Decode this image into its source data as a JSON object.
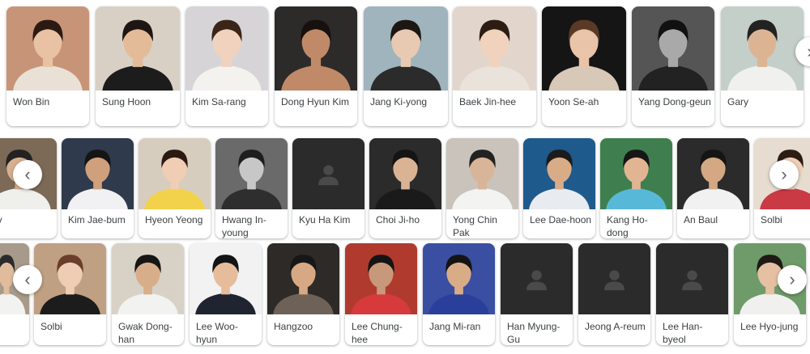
{
  "colors": {
    "placeholder_bg": "#2b2b2b",
    "placeholder_icon": "#4a4a4a",
    "label": "#3c4043"
  },
  "icons": {
    "prev": "chevron-left-icon",
    "next": "chevron-right-icon",
    "placeholder": "person-placeholder-icon"
  },
  "rows": [
    {
      "items": [
        {
          "name": "Won Bin",
          "bg": "#c89478",
          "skin": "#e9c2a3",
          "hair": "#2a1a12",
          "cloth": "#e9e1d6"
        },
        {
          "name": "Sung Hoon",
          "bg": "#d8d0c4",
          "skin": "#e3bb98",
          "hair": "#1d1612",
          "cloth": "#1c1c1c"
        },
        {
          "name": "Kim Sa-rang",
          "bg": "#d6d4d6",
          "skin": "#f0d2bf",
          "hair": "#3b2418",
          "cloth": "#f4f2ef"
        },
        {
          "name": "Dong Hyun Kim",
          "bg": "#2d2a2a",
          "skin": "#c08a68",
          "hair": "#16110e",
          "cloth": "#c08a68"
        },
        {
          "name": "Jang Ki-yong",
          "bg": "#9fb4bd",
          "skin": "#e8c9b1",
          "hair": "#1c1712",
          "cloth": "#2b2b2b"
        },
        {
          "name": "Baek Jin-hee",
          "bg": "#e2d6cc",
          "skin": "#f1d2bc",
          "hair": "#2c1c14",
          "cloth": "#e9e3dc"
        },
        {
          "name": "Yoon Se-ah",
          "bg": "#151515",
          "skin": "#e9c4a8",
          "hair": "#5a3a26",
          "cloth": "#d8c8b8"
        },
        {
          "name": "Yang Dong-geun",
          "bg": "#555555",
          "skin": "#a9a9a9",
          "hair": "#111111",
          "cloth": "#222222"
        },
        {
          "name": "Gary",
          "bg": "#c5cfc9",
          "skin": "#dcb494",
          "hair": "#222222",
          "cloth": "#f0f0ee"
        }
      ]
    },
    {
      "items": [
        {
          "name": "ary",
          "bg": "#7c6a56",
          "skin": "#d8b090",
          "hair": "#222222",
          "cloth": "#efefec"
        },
        {
          "name": "Kim Jae-bum",
          "bg": "#2f3a4c",
          "skin": "#d0a07c",
          "hair": "#151515",
          "cloth": "#f1f1f3"
        },
        {
          "name": "Hyeon Yeong",
          "bg": "#d7cdbf",
          "skin": "#f0cdb4",
          "hair": "#2a1a12",
          "cloth": "#f2d24a"
        },
        {
          "name": "Hwang In-young",
          "bg": "#6a6a6a",
          "skin": "#c7c7c7",
          "hair": "#1e1e1e",
          "cloth": "#2e2e2e"
        },
        {
          "name": "Kyu Ha Kim",
          "placeholder": true
        },
        {
          "name": "Choi Ji-ho",
          "bg": "#2b2b2b",
          "skin": "#d9b394",
          "hair": "#141414",
          "cloth": "#1a1a1a"
        },
        {
          "name": "Yong Chin Pak",
          "bg": "#c9c3bb",
          "skin": "#d8b498",
          "hair": "#222222",
          "cloth": "#f3f3f1"
        },
        {
          "name": "Lee Dae-hoon",
          "bg": "#1f5a8c",
          "skin": "#d9ac88",
          "hair": "#1b1b1b",
          "cloth": "#e8ecf0"
        },
        {
          "name": "Kang Ho-dong",
          "bg": "#3f7f4f",
          "skin": "#e2b592",
          "hair": "#161616",
          "cloth": "#58b8d8"
        },
        {
          "name": "An Baul",
          "bg": "#2b2b2b",
          "skin": "#d3a882",
          "hair": "#151515",
          "cloth": "#f1f1f1"
        },
        {
          "name": "Solbi",
          "bg": "#e6dccf",
          "skin": "#efcfb8",
          "hair": "#2c1c14",
          "cloth": "#c93a45"
        }
      ]
    },
    {
      "items": [
        {
          "name": "",
          "bg": "#a89a8a",
          "skin": "#e0bc9c",
          "hair": "#2b2b2b",
          "cloth": "#f2f2f0"
        },
        {
          "name": "Solbi",
          "bg": "#c0a082",
          "skin": "#efcdb4",
          "hair": "#6a3e2a",
          "cloth": "#1c1c1c"
        },
        {
          "name": "Gwak Dong-han",
          "bg": "#d8d2c6",
          "skin": "#d8ae8a",
          "hair": "#161616",
          "cloth": "#f2f2f0"
        },
        {
          "name": "Lee Woo-hyun",
          "bg": "#f2f2f2",
          "skin": "#e6bc9a",
          "hair": "#141414",
          "cloth": "#1f2430"
        },
        {
          "name": "Hangzoo",
          "bg": "#2e2a28",
          "skin": "#d6a884",
          "hair": "#171717",
          "cloth": "#6e6258"
        },
        {
          "name": "Lee Chung-hee",
          "bg": "#b13a2e",
          "skin": "#c8987a",
          "hair": "#141414",
          "cloth": "#d63a3a"
        },
        {
          "name": "Jang Mi-ran",
          "bg": "#3a4fa2",
          "skin": "#d9ac88",
          "hair": "#141414",
          "cloth": "#2a3f9a"
        },
        {
          "name": "Han Myung-Gu",
          "placeholder": true
        },
        {
          "name": "Jeong A-reum",
          "placeholder": true
        },
        {
          "name": "Lee Han-byeol",
          "placeholder": true
        },
        {
          "name": "Lee Hyo-jung",
          "bg": "#6f9a6a",
          "skin": "#e6c0a2",
          "hair": "#1f1a16",
          "cloth": "#f0f0ee"
        }
      ]
    }
  ]
}
